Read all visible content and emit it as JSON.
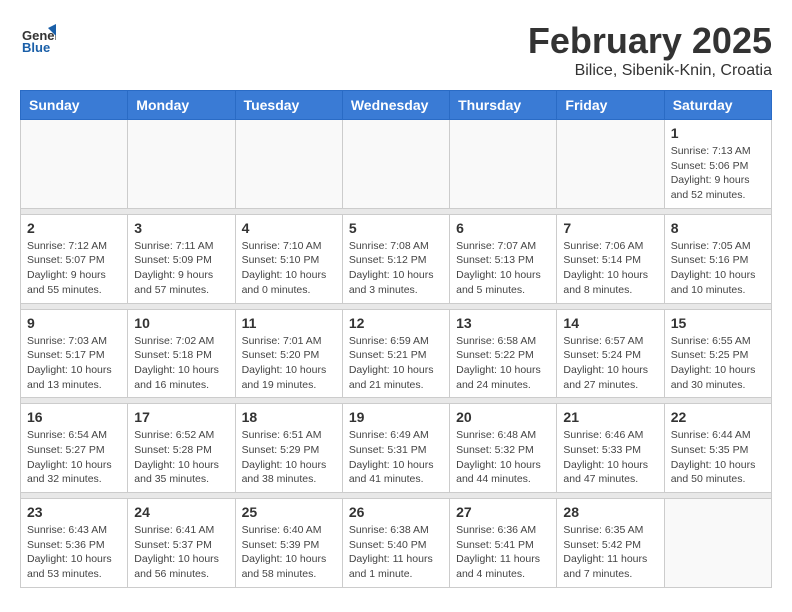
{
  "header": {
    "logo_general": "General",
    "logo_blue": "Blue",
    "month_title": "February 2025",
    "subtitle": "Bilice, Sibenik-Knin, Croatia"
  },
  "days_of_week": [
    "Sunday",
    "Monday",
    "Tuesday",
    "Wednesday",
    "Thursday",
    "Friday",
    "Saturday"
  ],
  "weeks": [
    {
      "days": [
        {
          "date": "",
          "info": ""
        },
        {
          "date": "",
          "info": ""
        },
        {
          "date": "",
          "info": ""
        },
        {
          "date": "",
          "info": ""
        },
        {
          "date": "",
          "info": ""
        },
        {
          "date": "",
          "info": ""
        },
        {
          "date": "1",
          "info": "Sunrise: 7:13 AM\nSunset: 5:06 PM\nDaylight: 9 hours and 52 minutes."
        }
      ]
    },
    {
      "days": [
        {
          "date": "2",
          "info": "Sunrise: 7:12 AM\nSunset: 5:07 PM\nDaylight: 9 hours and 55 minutes."
        },
        {
          "date": "3",
          "info": "Sunrise: 7:11 AM\nSunset: 5:09 PM\nDaylight: 9 hours and 57 minutes."
        },
        {
          "date": "4",
          "info": "Sunrise: 7:10 AM\nSunset: 5:10 PM\nDaylight: 10 hours and 0 minutes."
        },
        {
          "date": "5",
          "info": "Sunrise: 7:08 AM\nSunset: 5:12 PM\nDaylight: 10 hours and 3 minutes."
        },
        {
          "date": "6",
          "info": "Sunrise: 7:07 AM\nSunset: 5:13 PM\nDaylight: 10 hours and 5 minutes."
        },
        {
          "date": "7",
          "info": "Sunrise: 7:06 AM\nSunset: 5:14 PM\nDaylight: 10 hours and 8 minutes."
        },
        {
          "date": "8",
          "info": "Sunrise: 7:05 AM\nSunset: 5:16 PM\nDaylight: 10 hours and 10 minutes."
        }
      ]
    },
    {
      "days": [
        {
          "date": "9",
          "info": "Sunrise: 7:03 AM\nSunset: 5:17 PM\nDaylight: 10 hours and 13 minutes."
        },
        {
          "date": "10",
          "info": "Sunrise: 7:02 AM\nSunset: 5:18 PM\nDaylight: 10 hours and 16 minutes."
        },
        {
          "date": "11",
          "info": "Sunrise: 7:01 AM\nSunset: 5:20 PM\nDaylight: 10 hours and 19 minutes."
        },
        {
          "date": "12",
          "info": "Sunrise: 6:59 AM\nSunset: 5:21 PM\nDaylight: 10 hours and 21 minutes."
        },
        {
          "date": "13",
          "info": "Sunrise: 6:58 AM\nSunset: 5:22 PM\nDaylight: 10 hours and 24 minutes."
        },
        {
          "date": "14",
          "info": "Sunrise: 6:57 AM\nSunset: 5:24 PM\nDaylight: 10 hours and 27 minutes."
        },
        {
          "date": "15",
          "info": "Sunrise: 6:55 AM\nSunset: 5:25 PM\nDaylight: 10 hours and 30 minutes."
        }
      ]
    },
    {
      "days": [
        {
          "date": "16",
          "info": "Sunrise: 6:54 AM\nSunset: 5:27 PM\nDaylight: 10 hours and 32 minutes."
        },
        {
          "date": "17",
          "info": "Sunrise: 6:52 AM\nSunset: 5:28 PM\nDaylight: 10 hours and 35 minutes."
        },
        {
          "date": "18",
          "info": "Sunrise: 6:51 AM\nSunset: 5:29 PM\nDaylight: 10 hours and 38 minutes."
        },
        {
          "date": "19",
          "info": "Sunrise: 6:49 AM\nSunset: 5:31 PM\nDaylight: 10 hours and 41 minutes."
        },
        {
          "date": "20",
          "info": "Sunrise: 6:48 AM\nSunset: 5:32 PM\nDaylight: 10 hours and 44 minutes."
        },
        {
          "date": "21",
          "info": "Sunrise: 6:46 AM\nSunset: 5:33 PM\nDaylight: 10 hours and 47 minutes."
        },
        {
          "date": "22",
          "info": "Sunrise: 6:44 AM\nSunset: 5:35 PM\nDaylight: 10 hours and 50 minutes."
        }
      ]
    },
    {
      "days": [
        {
          "date": "23",
          "info": "Sunrise: 6:43 AM\nSunset: 5:36 PM\nDaylight: 10 hours and 53 minutes."
        },
        {
          "date": "24",
          "info": "Sunrise: 6:41 AM\nSunset: 5:37 PM\nDaylight: 10 hours and 56 minutes."
        },
        {
          "date": "25",
          "info": "Sunrise: 6:40 AM\nSunset: 5:39 PM\nDaylight: 10 hours and 58 minutes."
        },
        {
          "date": "26",
          "info": "Sunrise: 6:38 AM\nSunset: 5:40 PM\nDaylight: 11 hours and 1 minute."
        },
        {
          "date": "27",
          "info": "Sunrise: 6:36 AM\nSunset: 5:41 PM\nDaylight: 11 hours and 4 minutes."
        },
        {
          "date": "28",
          "info": "Sunrise: 6:35 AM\nSunset: 5:42 PM\nDaylight: 11 hours and 7 minutes."
        },
        {
          "date": "",
          "info": ""
        }
      ]
    }
  ]
}
